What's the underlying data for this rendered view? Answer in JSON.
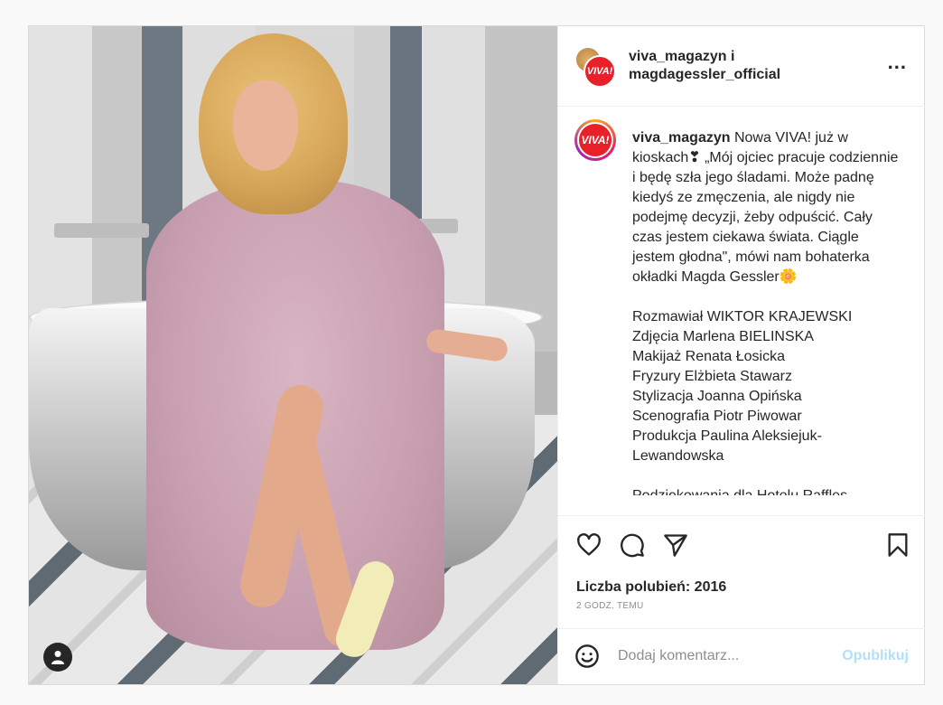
{
  "post": {
    "photo_alt": "Magda Gessler in pink robe on bathtub",
    "user_tag_icon": "user-tag-icon"
  },
  "header": {
    "author_line1": "viva_magazyn i",
    "author_line2": "magdagessler_official",
    "more": "...",
    "logo_text": "VIVA!"
  },
  "caption": {
    "username": "viva_magazyn",
    "lines": [
      "Nowa VIVA! już w kioskach❣ „Mój ojciec pracuje codziennie i będę szła jego śladami. Może padnę kiedyś ze zmęczenia, ale nigdy nie podejmę decyzji, żeby odpuścić. Cały czas jestem ciekawa świata. Ciągle jestem głodna\", mówi nam bohaterka okładki Magda Gessler🌼"
    ],
    "credits": [
      "Rozmawiał WIKTOR KRAJEWSKI",
      "Zdjęcia Marlena BIELINSKA",
      "Makijaż Renata Łosicka",
      "Fryzury Elżbieta Stawarz",
      "Stylizacja Joanna Opińska",
      "Scenografia Piotr Piwowar",
      "Produkcja Paulina Aleksiejuk-Lewandowska"
    ],
    "cut_line": "Podziękowania dla Hotelu Raffles"
  },
  "actions": {
    "icons": [
      "heart-icon",
      "comment-icon",
      "share-icon",
      "bookmark-icon"
    ]
  },
  "stats": {
    "likes": "Liczba polubień: 2016",
    "time": "2 GODZ. TEMU"
  },
  "comment": {
    "placeholder": "Dodaj komentarz...",
    "post_label": "Opublikuj"
  }
}
